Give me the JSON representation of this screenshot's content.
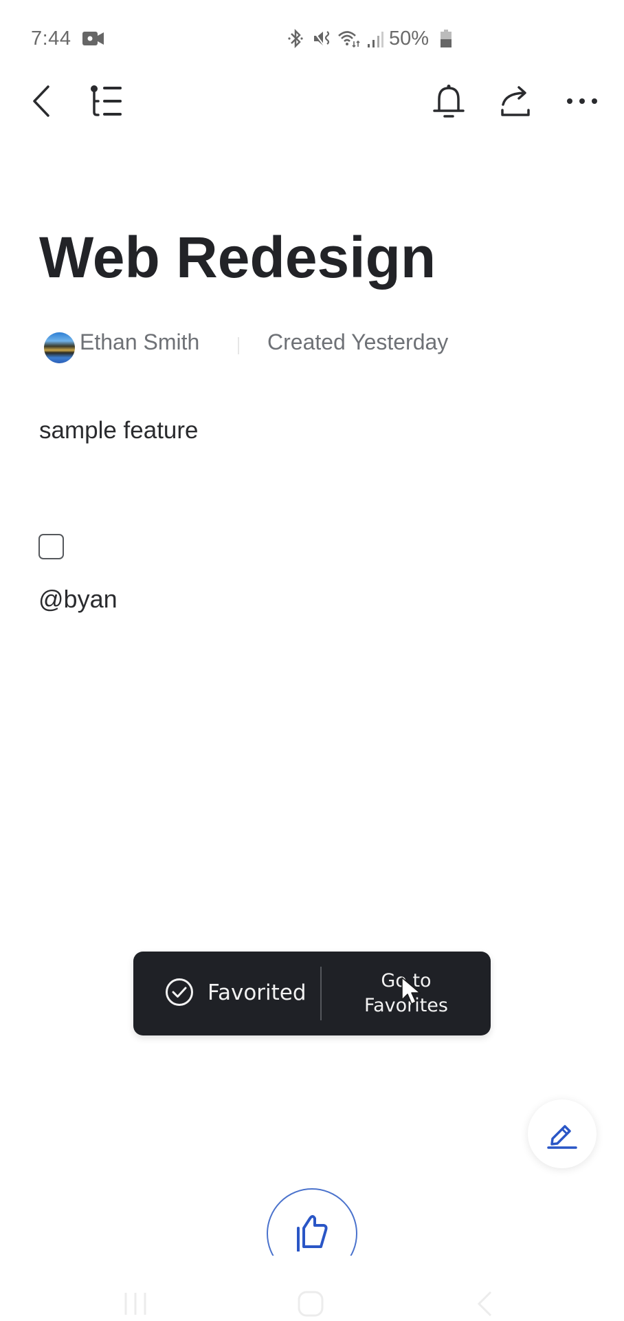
{
  "status_bar": {
    "time": "7:44",
    "battery_percent": "50%",
    "icons": [
      "video-record-icon",
      "bluetooth-icon",
      "mute-vibrate-icon",
      "wifi-icon",
      "signal-icon",
      "battery-icon"
    ]
  },
  "app_bar": {
    "left_icons": [
      "back-icon",
      "outline-icon"
    ],
    "right_icons": [
      "bell-icon",
      "share-icon",
      "more-icon"
    ]
  },
  "page": {
    "title": "Web Redesign",
    "author": "Ethan Smith",
    "created": "Created Yesterday",
    "body_text": "sample feature",
    "checkbox_checked": false,
    "mention": "@byan"
  },
  "toast": {
    "label": "Favorited",
    "action_line1": "Go to",
    "action_line2": "Favorites"
  },
  "colors": {
    "accent": "#2a56c6",
    "toast_bg": "#1f2126",
    "text_primary": "#222327",
    "text_secondary": "#6e7176"
  },
  "nav_bar": {
    "buttons": [
      "recents-icon",
      "home-icon",
      "back-nav-icon"
    ]
  }
}
